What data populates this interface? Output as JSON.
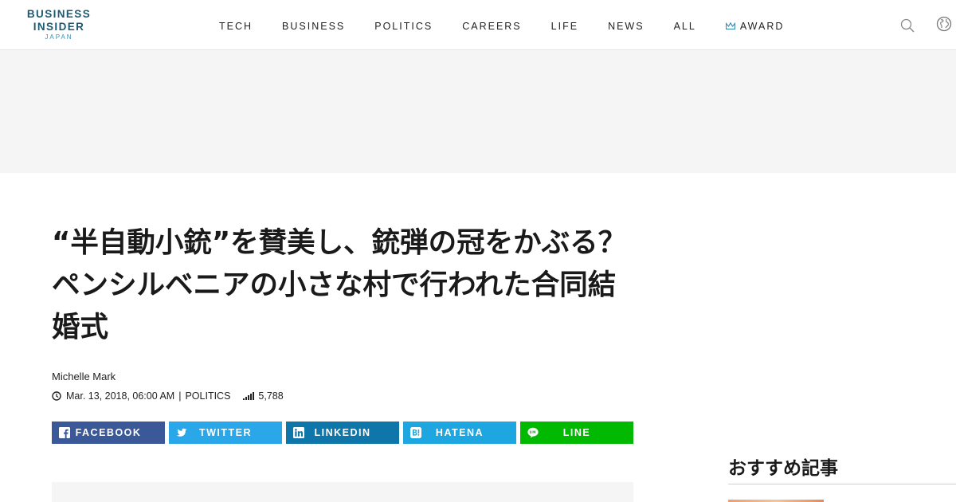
{
  "logo": {
    "line1": "BUSINESS",
    "line2": "INSIDER",
    "line3": "JAPAN",
    "color": "#1c5a73"
  },
  "nav": {
    "items": [
      {
        "label": "TECH"
      },
      {
        "label": "BUSINESS"
      },
      {
        "label": "POLITICS"
      },
      {
        "label": "CAREERS"
      },
      {
        "label": "LIFE"
      },
      {
        "label": "NEWS"
      },
      {
        "label": "ALL"
      }
    ],
    "award": {
      "label": "AWARD",
      "icon": "award-crown-icon"
    },
    "search_icon": "search-icon",
    "globe_icon": "globe-icon"
  },
  "article": {
    "headline": "“半自動小銃”を賛美し、銃弾の冠をかぶる？ ペンシルベニアの小さな村で行われた合同結婚式",
    "author": "Michelle Mark",
    "date": "Mar. 13, 2018, 06:00 AM",
    "separator": "|",
    "category": "POLITICS",
    "views": "5,788"
  },
  "share": {
    "facebook": {
      "label": "FACEBOOK",
      "color": "#3b5998"
    },
    "twitter": {
      "label": "TWITTER",
      "color": "#2aa7e8"
    },
    "linkedin": {
      "label": "LINKEDIN",
      "color": "#0e76a8"
    },
    "hatena": {
      "label": "HATENA",
      "color": "#1ea6e0"
    },
    "line": {
      "label": "LINE",
      "color": "#00b900"
    }
  },
  "sidebar": {
    "recommended_title": "おすすめ記事"
  }
}
